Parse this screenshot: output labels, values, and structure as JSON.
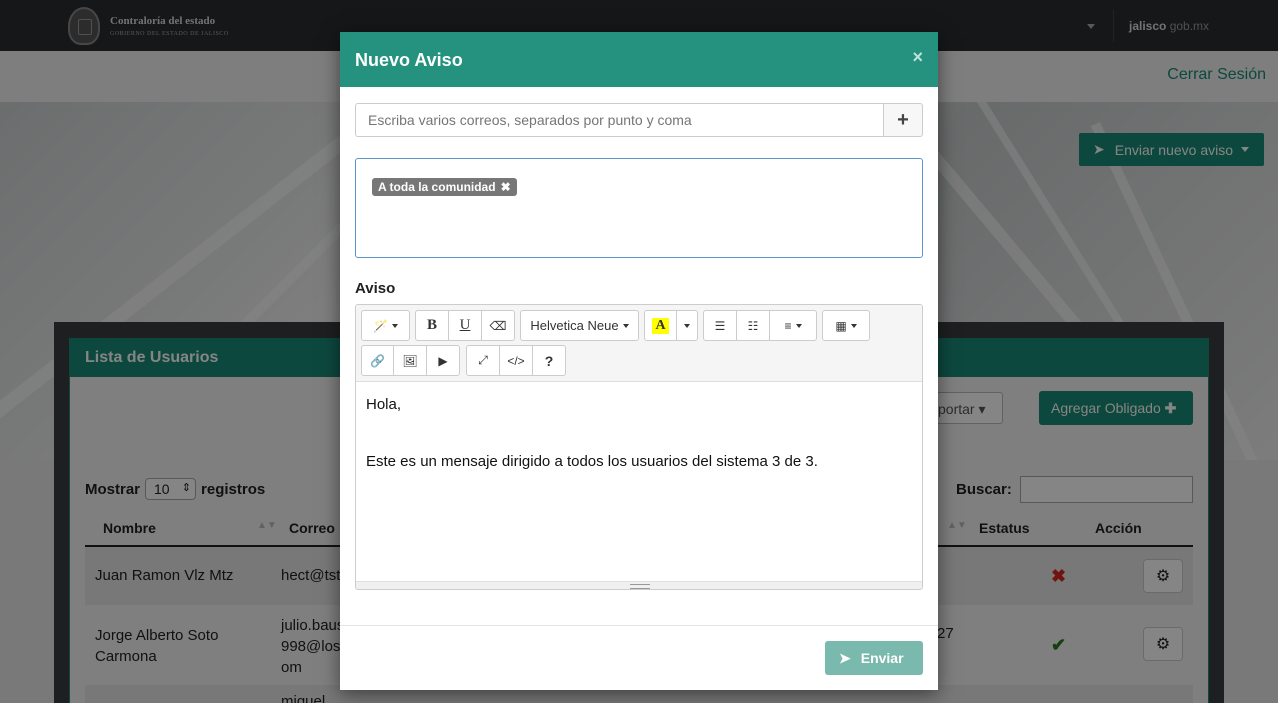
{
  "header": {
    "logo_title": "Contraloría del estado",
    "logo_subtitle": "GOBIERNO DEL ESTADO DE JALISCO",
    "brand_bold": "jalisco",
    "brand_light": " gob.mx"
  },
  "subnav": {
    "logout": "Cerrar Sesión"
  },
  "hero": {
    "send_new_label": "Enviar nuevo aviso"
  },
  "panel": {
    "title": "Lista de Usuarios",
    "export_label": "xportar",
    "add_label": "Agregar Obligado",
    "show_label": "Mostrar",
    "show_value": "10",
    "records_label": "registros",
    "search_label": "Buscar:",
    "columns": [
      "Nombre",
      "Correo",
      "Estatus",
      "Acción"
    ],
    "rows": [
      {
        "name": "Juan Ramon Vlz Mtz",
        "email": "hect@tst",
        "extra": "",
        "status": "inactive"
      },
      {
        "name_line1": "Jorge Alberto Soto",
        "name_line2": "Carmona",
        "email_line1": "julio.baus",
        "email_line2": "998@los",
        "email_line3": "om",
        "extra": "27",
        "status": "active"
      },
      {
        "email": "miguel"
      }
    ]
  },
  "modal": {
    "title": "Nuevo Aviso",
    "close": "×",
    "email_placeholder": "Escriba varios correos, separados por punto y coma",
    "add_symbol": "+",
    "tags": [
      "A toda la comunidad"
    ],
    "aviso_label": "Aviso",
    "font_name": "Helvetica Neue",
    "body_line1": "Hola,",
    "body_line2": "Este es un mensaje dirigido a todos los usuarios del sistema 3 de 3.",
    "send_label": "Enviar"
  },
  "colors": {
    "accent": "#1a8a77",
    "modal_header": "#25917f",
    "send_disabled": "#7ab9ad"
  }
}
